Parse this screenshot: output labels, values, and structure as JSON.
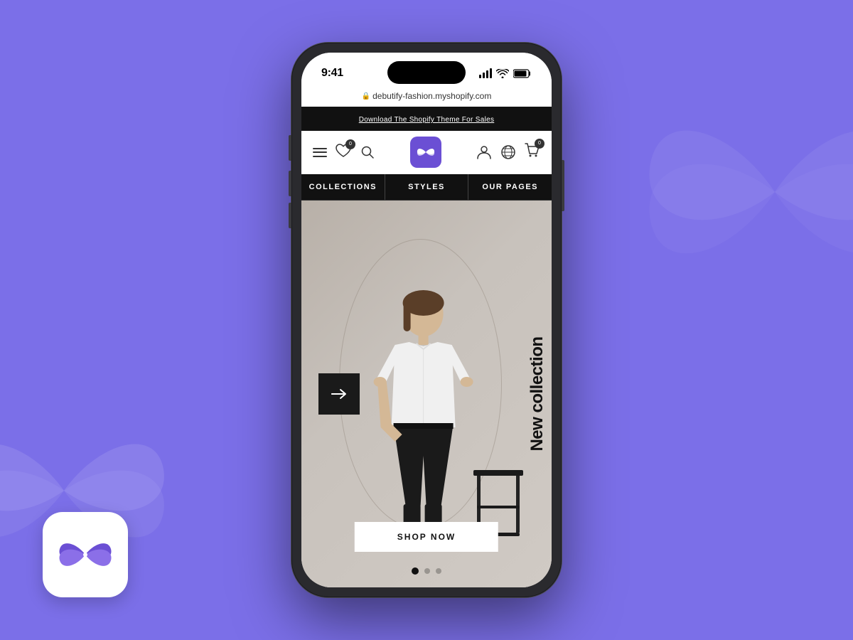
{
  "background": {
    "color": "#7B6FE8"
  },
  "app_icon": {
    "label": "Debutify Fashion App Icon"
  },
  "phone": {
    "status_bar": {
      "time": "9:41",
      "signal_bars": 4,
      "wifi": true,
      "battery": true
    },
    "url_bar": {
      "url": "debutify-fashion.myshopify.com",
      "secure": true
    },
    "promo_banner": {
      "text": "Download The Shopify Theme For Sales"
    },
    "nav": {
      "heart_count": "0",
      "cart_count": "0",
      "logo_alt": "Butterfly Logo"
    },
    "category_tabs": [
      {
        "label": "COLLECTIONS",
        "active": true
      },
      {
        "label": "STYLES",
        "active": false
      },
      {
        "label": "OUR PAGES",
        "active": false
      }
    ],
    "hero": {
      "new_collection_text": "New collection",
      "shop_now_label": "SHOP NOW",
      "arrow_label": "→"
    },
    "carousel": {
      "dots": [
        true,
        false,
        false
      ],
      "active_index": 0
    }
  }
}
